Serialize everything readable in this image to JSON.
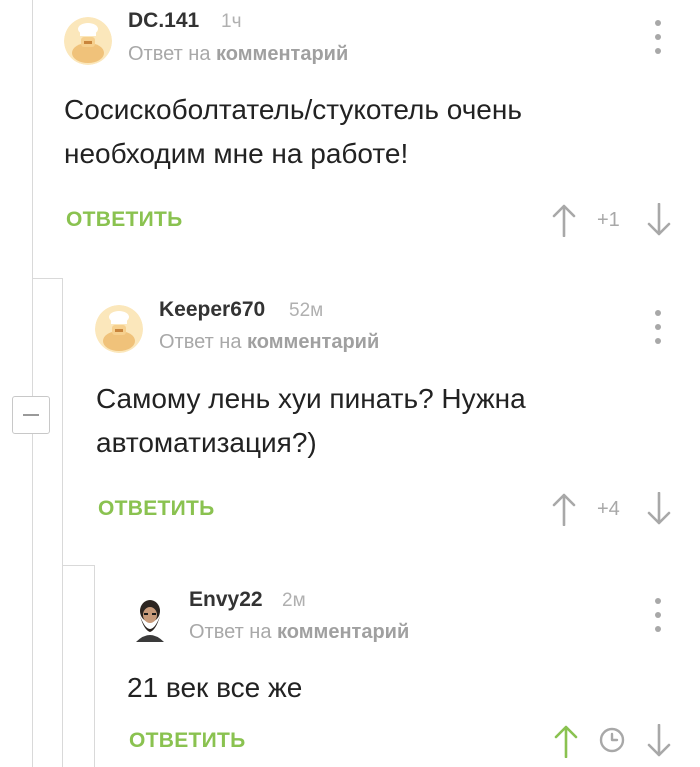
{
  "comments": [
    {
      "username": "DC.141",
      "time": "1ч",
      "reply_prefix": "Ответ на",
      "reply_target": "комментарий",
      "body_lines": [
        "Сосискоболтатель/стукотель очень",
        "необходим мне на работе!"
      ],
      "reply_label": "ОТВЕТИТЬ",
      "rating": "+1",
      "avatar": "chef-avatar-icon"
    },
    {
      "username": "Keeper670",
      "time": "52м",
      "reply_prefix": "Ответ на",
      "reply_target": "комментарий",
      "body_lines": [
        "Самому лень хуи пинать? Нужна",
        "автоматизация?)"
      ],
      "reply_label": "ОТВЕТИТЬ",
      "rating": "+4",
      "avatar": "chef-avatar-icon"
    },
    {
      "username": "Envy22",
      "time": "2м",
      "reply_prefix": "Ответ на",
      "reply_target": "комментарий",
      "body_lines": [
        "21 век все же"
      ],
      "reply_label": "ОТВЕТИТЬ",
      "rating_icon": "clock-icon",
      "avatar": "bearded-man-avatar-icon"
    }
  ],
  "colors": {
    "accent_green": "#8ac250",
    "muted_gray": "#a8a8a8",
    "text": "#222222",
    "thread_line": "#d9d9d9"
  }
}
